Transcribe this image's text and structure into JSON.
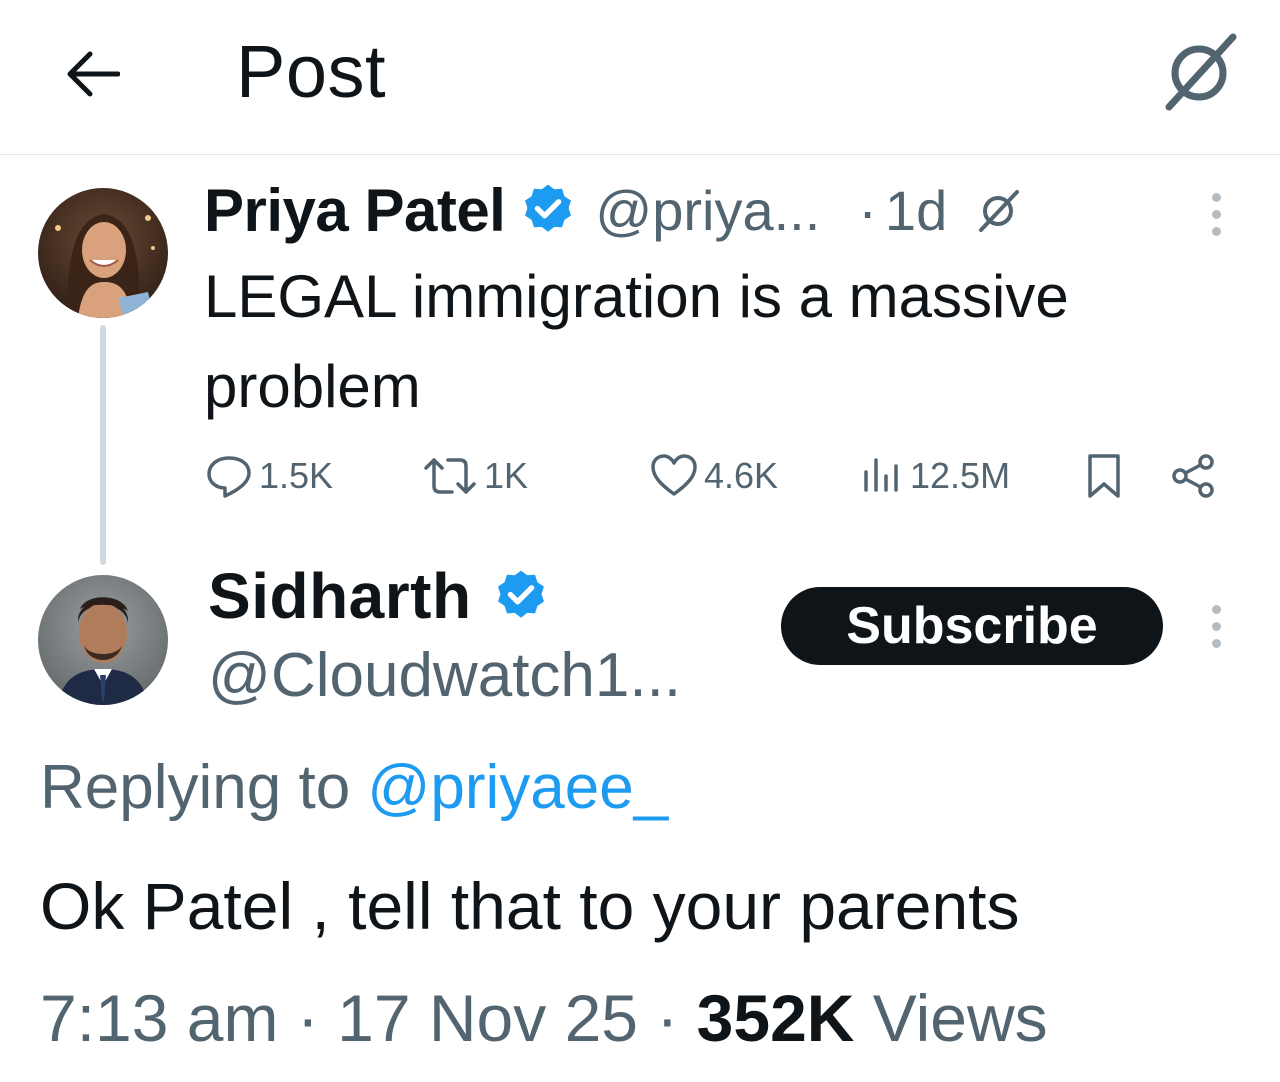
{
  "header": {
    "title": "Post",
    "back_icon": "arrow-left-icon",
    "grok_icon": "grok-icon"
  },
  "parent_post": {
    "display_name": "Priya Patel",
    "verified": true,
    "handle": "@priya...",
    "separator": "·",
    "time": "1d",
    "text": "LEGAL immigration is a massive problem",
    "stats": {
      "replies": "1.5K",
      "reposts": "1K",
      "likes": "4.6K",
      "views": "12.5M"
    }
  },
  "reply_post": {
    "display_name": "Sidharth",
    "verified": true,
    "handle": "@Cloudwatch1...",
    "subscribe_label": "Subscribe",
    "replying_prefix": "Replying to",
    "replying_mention": "@priyaee_",
    "text": "Ok Patel , tell that to your parents",
    "timestamp": "7:13 am · 17 Nov 25 · ",
    "views_count": "352K",
    "views_label": " Views"
  },
  "colors": {
    "text": "#0f1419",
    "secondary": "#536471",
    "accent": "#1d9bf0",
    "divider": "#e3e6e8",
    "button_bg": "#0f1419"
  }
}
